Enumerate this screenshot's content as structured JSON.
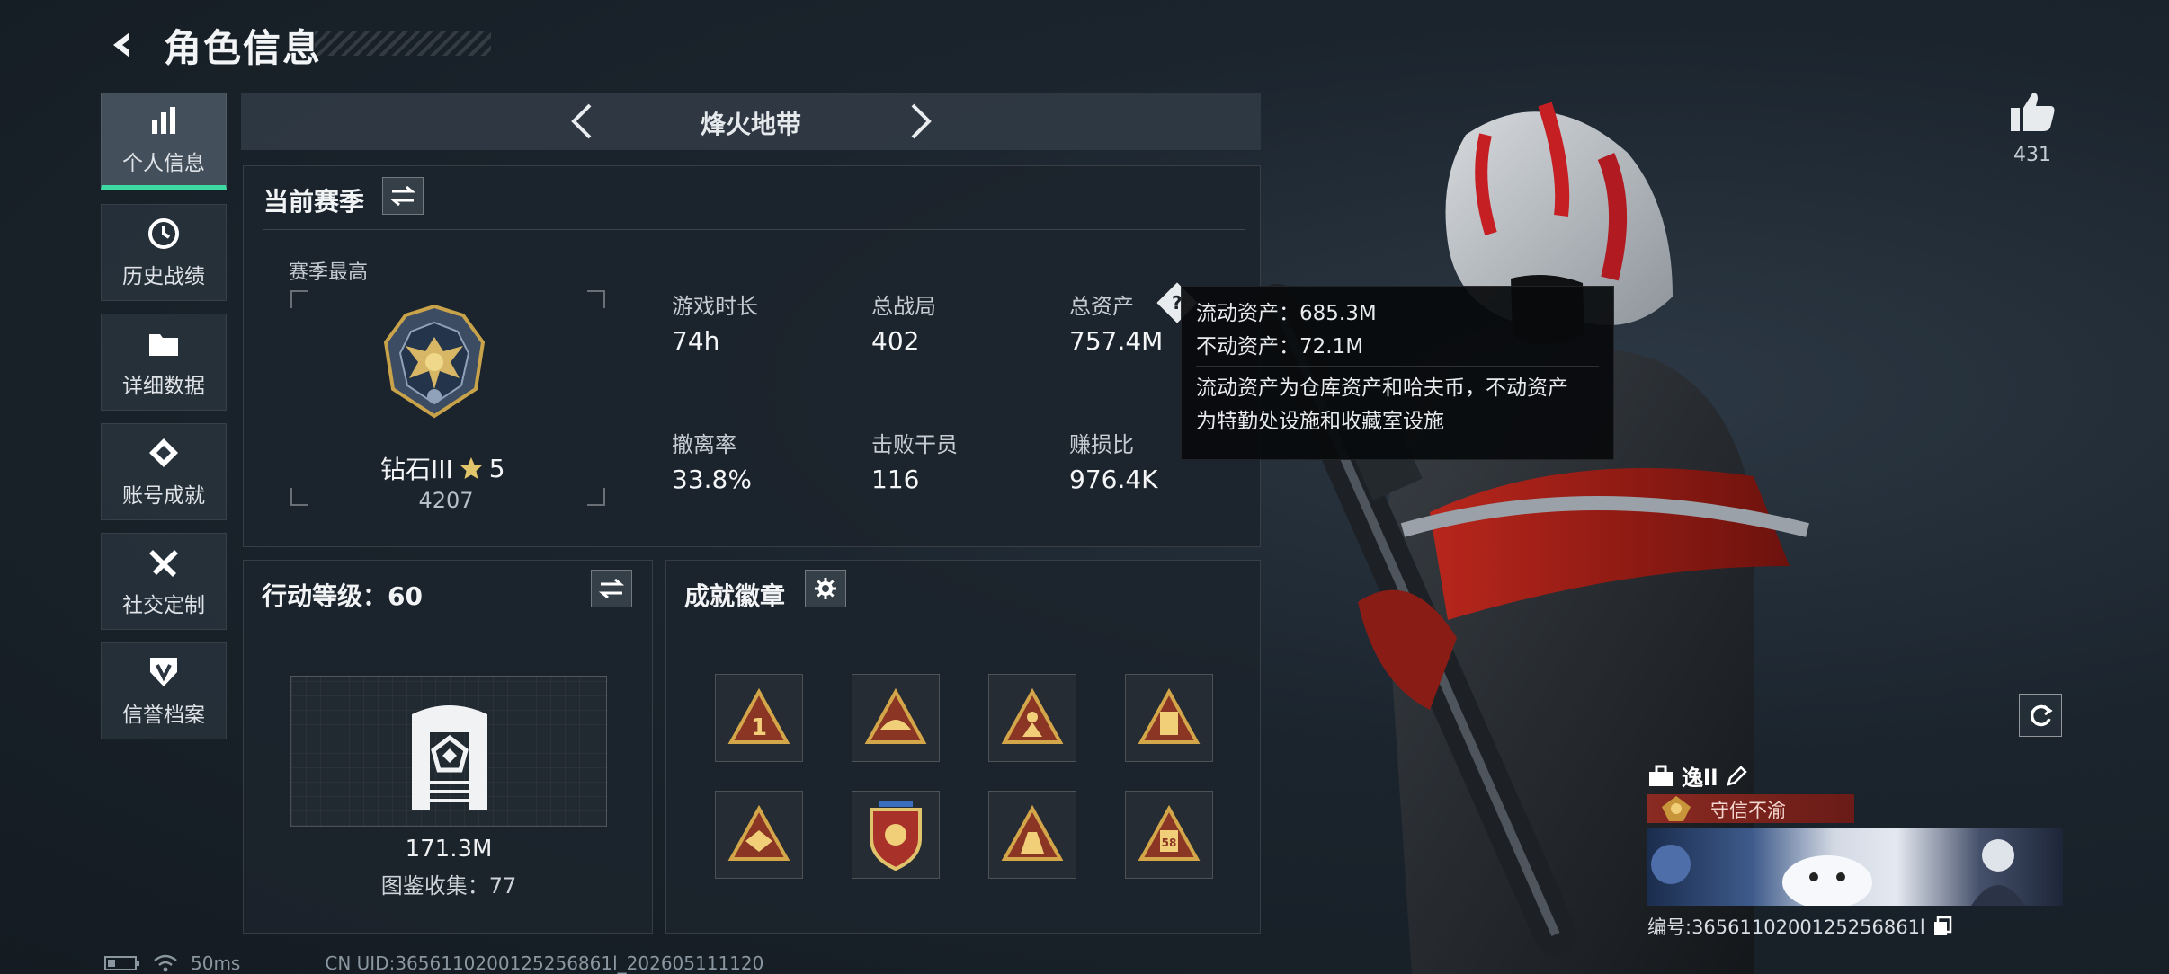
{
  "header": {
    "title": "角色信息"
  },
  "sidebar": {
    "items": [
      {
        "label": "个人信息",
        "icon": "bar-chart-icon",
        "active": true
      },
      {
        "label": "历史战绩",
        "icon": "history-icon"
      },
      {
        "label": "详细数据",
        "icon": "folder-icon"
      },
      {
        "label": "账号成就",
        "icon": "achievement-icon"
      },
      {
        "label": "社交定制",
        "icon": "tools-icon"
      },
      {
        "label": "信誉档案",
        "icon": "shield-icon"
      }
    ]
  },
  "mode": {
    "name": "烽火地带"
  },
  "season": {
    "title": "当前赛季",
    "best_label": "赛季最高",
    "rank_name": "钻石III",
    "rank_stars": "5",
    "rank_points": "4207",
    "stats": [
      {
        "label": "游戏时长",
        "value": "74h"
      },
      {
        "label": "总战局",
        "value": "402"
      },
      {
        "label": "总资产",
        "value": "757.4M"
      },
      {
        "label": "撤离率",
        "value": "33.8%"
      },
      {
        "label": "击败干员",
        "value": "116"
      },
      {
        "label": "赚损比",
        "value": "976.4K"
      }
    ]
  },
  "tooltip": {
    "line1": "流动资产：685.3M",
    "line2": "不动资产：72.1M",
    "desc1": "流动资产为仓库资产和哈夫币，不动资产",
    "desc2": "为特勤处设施和收藏室设施"
  },
  "level": {
    "title": "行动等级：60",
    "value": "171.3M",
    "collection": "图鉴收集：77"
  },
  "badges": {
    "title": "成就徽章",
    "items": [
      "badge-1",
      "badge-2",
      "badge-3",
      "badge-4",
      "badge-5",
      "badge-6",
      "badge-7",
      "badge-8"
    ]
  },
  "status": {
    "ping": "50ms",
    "uid": "CN UID:3656110200125256861l_202605111120"
  },
  "likes": {
    "count": "431"
  },
  "card": {
    "name": "逸ll",
    "title": "守信不渝",
    "uid": "编号:3656110200125256861l"
  },
  "colors": {
    "accent": "#3fd9a4",
    "gold": "#c9a34a",
    "title_red": "#8a2a22"
  }
}
